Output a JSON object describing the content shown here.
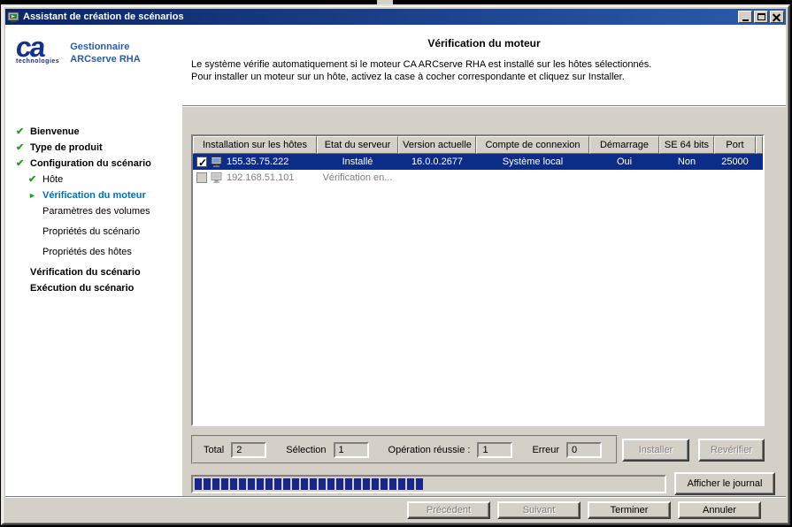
{
  "theme": {
    "titlebar-start": "#0b2569",
    "titlebar-end": "#2a5caa",
    "selection": "#0b2d88",
    "progress": "#16268c",
    "check": "#1fa11f",
    "current-step": "#0072bc",
    "brand": "#15318f"
  },
  "window": {
    "title": "Assistant de création de scénarios"
  },
  "sidebar": {
    "logo_text": "ca",
    "logo_sub": "technologies",
    "product_line1": "Gestionnaire",
    "product_line2": "ARCserve RHA",
    "steps": [
      {
        "label": "Bienvenue",
        "state": "done"
      },
      {
        "label": "Type de produit",
        "state": "done"
      },
      {
        "label": "Configuration du scénario",
        "state": "done"
      },
      {
        "label": "Hôte",
        "state": "done"
      },
      {
        "label": "Vérification du moteur",
        "state": "current"
      },
      {
        "label": "Paramètres des volumes",
        "state": "pending"
      },
      {
        "label": "Propriétés du scénario",
        "state": "pending"
      },
      {
        "label": "Propriétés des hôtes",
        "state": "pending"
      },
      {
        "label": "Vérification du scénario",
        "state": "upcoming"
      },
      {
        "label": "Exécution du scénario",
        "state": "upcoming"
      }
    ]
  },
  "main": {
    "title": "Vérification du moteur",
    "description_line1": "Le système vérifie automatiquement si le moteur CA ARCserve RHA est installé sur les hôtes sélectionnés.",
    "description_line2": "Pour installer un moteur sur un hôte, activez la case à cocher correspondante et cliquez sur Installer.",
    "table": {
      "columns": [
        "Installation sur les hôtes",
        "Etat du serveur",
        "Version actuelle",
        "Compte de connexion",
        "Démarrage",
        "SE 64 bits",
        "Port"
      ],
      "rows": [
        {
          "checked": true,
          "selected": true,
          "host": "155.35.75.222",
          "status": "Installé",
          "version": "16.0.0.2677",
          "account": "Système local",
          "startup": "Oui",
          "os64": "Non",
          "port": "25000"
        },
        {
          "checked": false,
          "selected": false,
          "host": "192.168.51.101",
          "status": "Vérification en...",
          "version": "",
          "account": "",
          "startup": "",
          "os64": "",
          "port": ""
        }
      ]
    },
    "summary": {
      "total_label": "Total",
      "total_value": "2",
      "selection_label": "Sélection",
      "selection_value": "1",
      "success_label": "Opération réussie :",
      "success_value": "1",
      "error_label": "Erreur",
      "error_value": "0"
    },
    "buttons": {
      "install": "Installer",
      "reverify": "Revérifier",
      "show_log": "Afficher le journal"
    },
    "progress": {
      "percent": 49
    }
  },
  "footer": {
    "previous": "Précédent",
    "next": "Suivant",
    "finish": "Terminer",
    "cancel": "Annuler"
  }
}
